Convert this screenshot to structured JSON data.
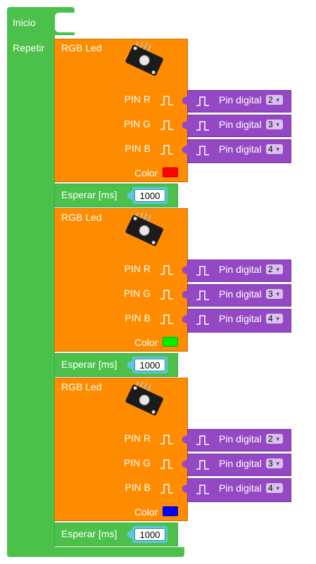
{
  "program": {
    "start_label": "Inicio",
    "loop_label": "Repetir"
  },
  "rgb_blocks": [
    {
      "title": "RGB Led",
      "pins": [
        {
          "label": "PIN R",
          "digital_label": "Pin digital",
          "value": "2"
        },
        {
          "label": "PIN G",
          "digital_label": "Pin digital",
          "value": "3"
        },
        {
          "label": "PIN B",
          "digital_label": "Pin digital",
          "value": "4"
        }
      ],
      "color_label": "Color",
      "color": "#ff0000"
    },
    {
      "title": "RGB Led",
      "pins": [
        {
          "label": "PIN R",
          "digital_label": "Pin digital",
          "value": "2"
        },
        {
          "label": "PIN G",
          "digital_label": "Pin digital",
          "value": "3"
        },
        {
          "label": "PIN B",
          "digital_label": "Pin digital",
          "value": "4"
        }
      ],
      "color_label": "Color",
      "color": "#00ee00"
    },
    {
      "title": "RGB Led",
      "pins": [
        {
          "label": "PIN R",
          "digital_label": "Pin digital",
          "value": "2"
        },
        {
          "label": "PIN G",
          "digital_label": "Pin digital",
          "value": "3"
        },
        {
          "label": "PIN B",
          "digital_label": "Pin digital",
          "value": "4"
        }
      ],
      "color_label": "Color",
      "color": "#0000ff"
    }
  ],
  "wait_blocks": [
    {
      "label": "Esperar [ms]",
      "value": "1000"
    },
    {
      "label": "Esperar [ms]",
      "value": "1000"
    },
    {
      "label": "Esperar [ms]",
      "value": "1000"
    }
  ],
  "colors": {
    "control": "#4bc14b",
    "rgb": "#ff8c00",
    "pin": "#9448c4",
    "number": "#5cc6db"
  }
}
